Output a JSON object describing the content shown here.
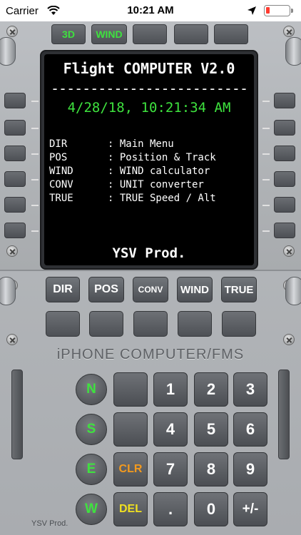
{
  "status_bar": {
    "carrier": "Carrier",
    "time": "10:21 AM",
    "battery_level": 0.15,
    "battery_color": "#ff3b30"
  },
  "top_buttons": [
    {
      "label": "3D"
    },
    {
      "label": "WIND"
    },
    {
      "label": ""
    },
    {
      "label": ""
    },
    {
      "label": ""
    }
  ],
  "screen": {
    "title": "Flight COMPUTER V2.0",
    "divider": "-------------------------",
    "datetime": "4/28/18, 10:21:34 AM",
    "menu": [
      {
        "key": "DIR",
        "sep": ": ",
        "desc": "Main Menu"
      },
      {
        "key": "POS",
        "sep": ": ",
        "desc": "Position & Track"
      },
      {
        "key": "WIND",
        "sep": ": ",
        "desc": "WIND calculator"
      },
      {
        "key": "CONV",
        "sep": ": ",
        "desc": "UNIT converter"
      },
      {
        "key": "TRUE",
        "sep": ": ",
        "desc": "TRUE Speed / Alt"
      }
    ],
    "footer": "YSV Prod.",
    "accent_color": "#3ee23e"
  },
  "function_buttons": [
    {
      "label": "DIR"
    },
    {
      "label": "POS"
    },
    {
      "label": "CONV"
    },
    {
      "label": "WIND"
    },
    {
      "label": "TRUE"
    }
  ],
  "brand": "iPHONE COMPUTER/FMS",
  "keypad": {
    "directions": [
      "N",
      "S",
      "E",
      "W"
    ],
    "clr": "CLR",
    "del": "DEL",
    "clr_color": "#f39a1e",
    "del_color": "#f0e020",
    "digits": [
      "1",
      "2",
      "3",
      "4",
      "5",
      "6",
      "7",
      "8",
      "9",
      ".",
      "0",
      "+/-"
    ]
  },
  "footer_brand": "YSV Prod."
}
